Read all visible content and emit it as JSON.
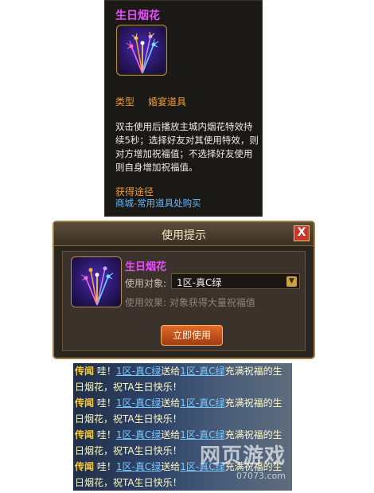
{
  "tooltip": {
    "title": "生日烟花",
    "type_label": "类型",
    "type_value": "婚宴道具",
    "description": "双击使用后播放主城内烟花特效持续5秒；选择好友对其使用特效，则对方增加祝福值；不选择好友使用则自身增加祝福值。",
    "source_heading": "获得途径",
    "source_value": "商城-常用道具处购买",
    "icon": "fireworks-icon"
  },
  "dialog": {
    "title": "使用提示",
    "close_label": "X",
    "item_name": "生日烟花",
    "target_label": "使用对象:",
    "target_value": "1区-真C绿",
    "effect_label": "使用效果: 对象获得大量祝福值",
    "use_button": "立即使用"
  },
  "chat": {
    "lines": [
      {
        "tag": "传闻",
        "pre": "哇！",
        "from": "1区-真C绿",
        "mid": "送给",
        "to": "1区-真C绿",
        "post": "充满祝福的生日烟花，祝TA生日快乐！"
      },
      {
        "tag": "传闻",
        "pre": "哇！",
        "from": "1区-真C绿",
        "mid": "送给",
        "to": "1区-真C绿",
        "post": "充满祝福的生日烟花，祝TA生日快乐！"
      },
      {
        "tag": "传闻",
        "pre": "哇！",
        "from": "1区-真C绿",
        "mid": "送给",
        "to": "1区-真C绿",
        "post": "充满祝福的生日烟花，祝TA生日快乐！"
      },
      {
        "tag": "传闻",
        "pre": "哇！",
        "from": "1区-真C绿",
        "mid": "送给",
        "to": "1区-真C绿",
        "post": "充满祝福的生日烟花，祝TA生日快乐！"
      }
    ],
    "watermark_main": "网页游戏",
    "watermark_sub": "07073.com"
  },
  "colors": {
    "item_name": "#e94bff",
    "heading": "#f39b37",
    "link": "#62b7ff",
    "chat_tag": "#ffcc33"
  }
}
